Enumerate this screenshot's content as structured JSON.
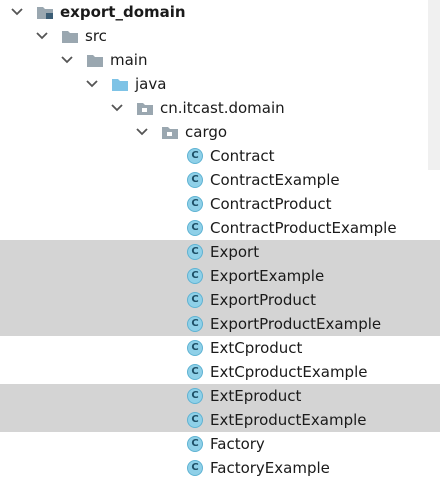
{
  "tree": {
    "project": {
      "label": "export_domain"
    },
    "src": {
      "label": "src"
    },
    "main": {
      "label": "main"
    },
    "java": {
      "label": "java"
    },
    "package": {
      "label": "cn.itcast.domain"
    },
    "cargo": {
      "label": "cargo"
    },
    "class_icon_letter": "C",
    "classes": [
      {
        "label": "Contract",
        "selected": false
      },
      {
        "label": "ContractExample",
        "selected": false
      },
      {
        "label": "ContractProduct",
        "selected": false
      },
      {
        "label": "ContractProductExample",
        "selected": false
      },
      {
        "label": "Export",
        "selected": true
      },
      {
        "label": "ExportExample",
        "selected": true
      },
      {
        "label": "ExportProduct",
        "selected": true
      },
      {
        "label": "ExportProductExample",
        "selected": true
      },
      {
        "label": "ExtCproduct",
        "selected": false
      },
      {
        "label": "ExtCproductExample",
        "selected": false
      },
      {
        "label": "ExtEproduct",
        "selected": true
      },
      {
        "label": "ExtEproductExample",
        "selected": true
      },
      {
        "label": "Factory",
        "selected": false
      },
      {
        "label": "FactoryExample",
        "selected": false
      }
    ]
  },
  "colors": {
    "selection": "#d4d4d4",
    "folder_gray": "#9aa7b0",
    "folder_blue": "#7ec3e6",
    "class_icon_fill": "#8fd0e8"
  },
  "icons": {
    "expand": "chevron-down-icon",
    "module": "module-folder-icon",
    "folder": "folder-icon",
    "source_root": "source-root-folder-icon",
    "package": "package-icon",
    "class": "class-icon"
  }
}
